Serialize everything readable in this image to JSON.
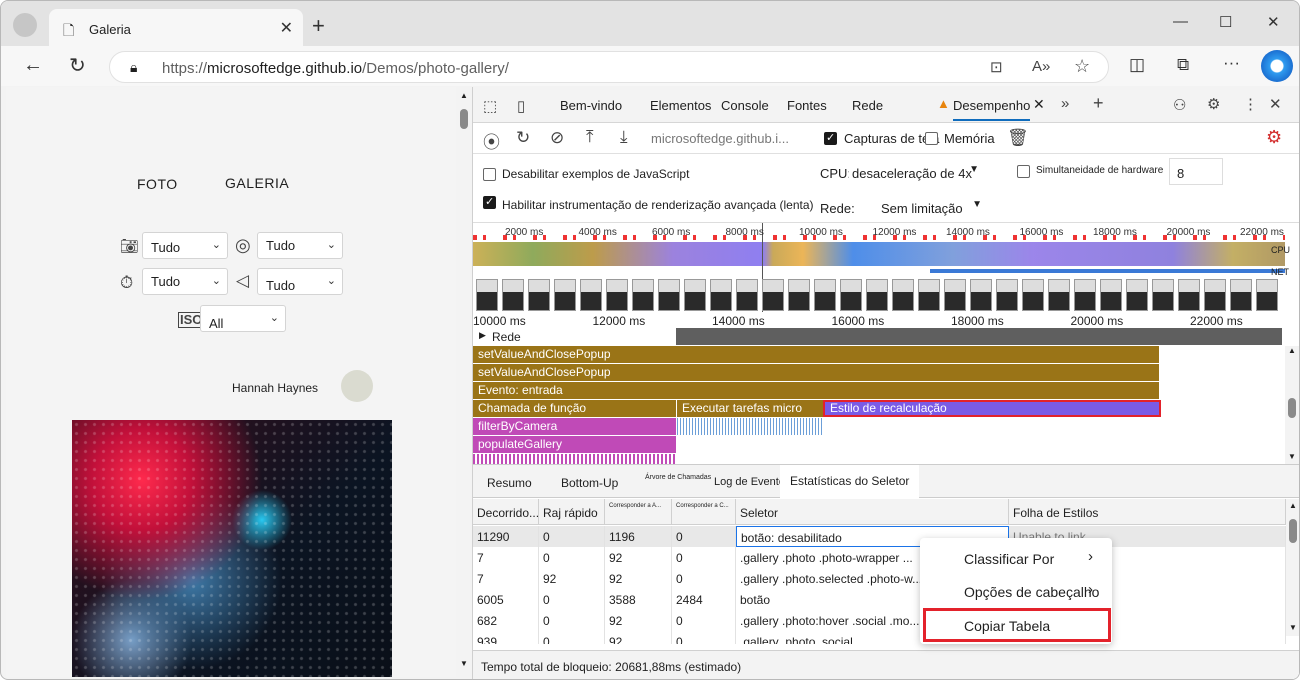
{
  "browser": {
    "tab_title": "Galeria",
    "url_protocol": "https://",
    "url_domain": "microsoftedge.github.io",
    "url_path": "/Demos/photo-gallery/"
  },
  "gallery": {
    "nav": [
      "FOTO",
      "GALERIA"
    ],
    "filters": {
      "camera": "Tudo",
      "aperture": "Tudo",
      "shutter": "Tudo",
      "sound": "Tudo",
      "iso": "All"
    },
    "user_name": "Hannah Haynes"
  },
  "devtools": {
    "tabs": [
      "Bem-vindo",
      "Elementos",
      "Console",
      "Fontes",
      "Rede",
      "Desempenho"
    ],
    "recording_target": "microsoftedge.github.i...",
    "screenshots_label": "Capturas de tela",
    "memory_label": "Memória",
    "disable_js_samples": "Desabilitar exemplos de JavaScript",
    "enable_render_instr": "Habilitar instrumentação de renderização avançada (lenta)",
    "cpu_label": "CPU:",
    "cpu_value": "desaceleração de 4x",
    "network_label": "Rede:",
    "network_value": "Sem limitação",
    "hw_concurrency_label": "Simultaneidade de hardware",
    "hw_concurrency_value": "8",
    "overview_ticks": [
      "2000 ms",
      "4000 ms",
      "6000 ms",
      "8000 ms",
      "10000 ms",
      "12000 ms",
      "14000 ms",
      "16000 ms",
      "18000 ms",
      "20000 ms",
      "22000 ms"
    ],
    "overview_labels": {
      "cpu": "CPU",
      "net": "NET"
    },
    "flame_ticks": [
      "10000 ms",
      "12000 ms",
      "14000 ms",
      "16000 ms",
      "18000 ms",
      "20000 ms",
      "22000 ms"
    ],
    "network_track": "Rede",
    "flame_bars": [
      "setValueAndClosePopup",
      "setValueAndClosePopup",
      "Evento: entrada",
      "Chamada de função",
      "Executar tarefas micro",
      "Estilo de recalculação",
      "filterByCamera",
      "populateGallery"
    ],
    "bottom_tabs": [
      "Resumo",
      "Bottom-Up",
      "Árvore de Chamadas",
      "Log de Eventos",
      "Estatísticas do Seletor"
    ],
    "table": {
      "headers": [
        "Decorrido...",
        "Raj rápido",
        "Corresponder a A...",
        "Corresponder a C...",
        "Seletor",
        "Folha de Estilos"
      ],
      "rows": [
        [
          "11290",
          "0",
          "1196",
          "0",
          "botão: desabilitado",
          "Unable to link"
        ],
        [
          "7",
          "0",
          "92",
          "0",
          ".gallery .photo .photo-wrapper ...",
          ""
        ],
        [
          "7",
          "92",
          "92",
          "0",
          ".gallery .photo.selected .photo-w...",
          ""
        ],
        [
          "6005",
          "0",
          "3588",
          "2484",
          "botão",
          ""
        ],
        [
          "682",
          "0",
          "92",
          "0",
          ".gallery .photo:hover .social .mo...",
          ""
        ],
        [
          "939",
          "0",
          "92",
          "0",
          ".gallery .photo .social",
          ""
        ]
      ]
    },
    "status": "Tempo total de bloqueio: 20681,88ms (estimado)",
    "context_menu": [
      "Classificar Por",
      "Opções de cabeçalho",
      "Copiar Tabela"
    ]
  }
}
